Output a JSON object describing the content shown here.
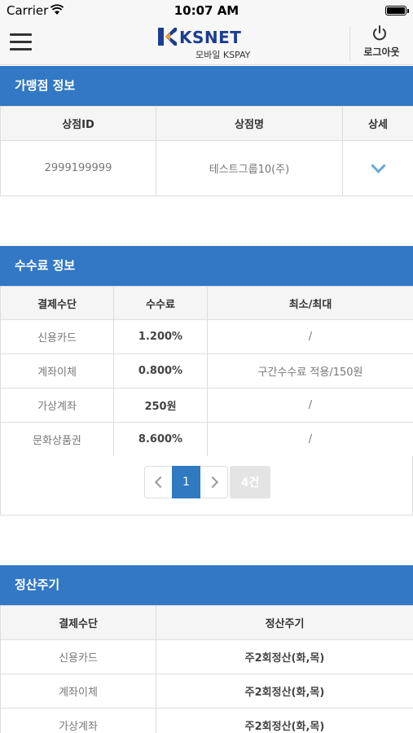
{
  "status_bar": {
    "carrier": "Carrier",
    "time": "10:07 AM"
  },
  "header": {
    "logo_text": "KSNET",
    "logo_subtitle": "모바일 KSPAY",
    "logout_label": "로그아웃"
  },
  "merchant": {
    "title": "가맹점 정보",
    "headers": [
      "상점ID",
      "상점명",
      "상세"
    ],
    "rows": [
      {
        "id": "2999199999",
        "name": "테스트그룹10(주)"
      }
    ]
  },
  "fees": {
    "title": "수수료 정보",
    "headers": [
      "결제수단",
      "수수료",
      "최소/최대"
    ],
    "rows": [
      {
        "method": "신용카드",
        "fee": "1.200%",
        "minmax": "/"
      },
      {
        "method": "계좌이체",
        "fee": "0.800%",
        "minmax": "구간수수료 적용/150원"
      },
      {
        "method": "가상계좌",
        "fee": "250원",
        "minmax": "/"
      },
      {
        "method": "문화상품권",
        "fee": "8.600%",
        "minmax": "/"
      }
    ],
    "pagination": {
      "current_page": "1",
      "total_count": "4건"
    }
  },
  "settlement": {
    "title": "정산주기",
    "headers": [
      "결제수단",
      "정산주기"
    ],
    "rows": [
      {
        "method": "신용카드",
        "cycle": "주2회정산(화,목)"
      },
      {
        "method": "계좌이체",
        "cycle": "주2회정산(화,목)"
      },
      {
        "method": "가상계좌",
        "cycle": "주2회정산(화,목)"
      }
    ]
  },
  "colors": {
    "accent": "#3278c4",
    "logo": "#1d3d8f",
    "chevron": "#6aa7da"
  }
}
